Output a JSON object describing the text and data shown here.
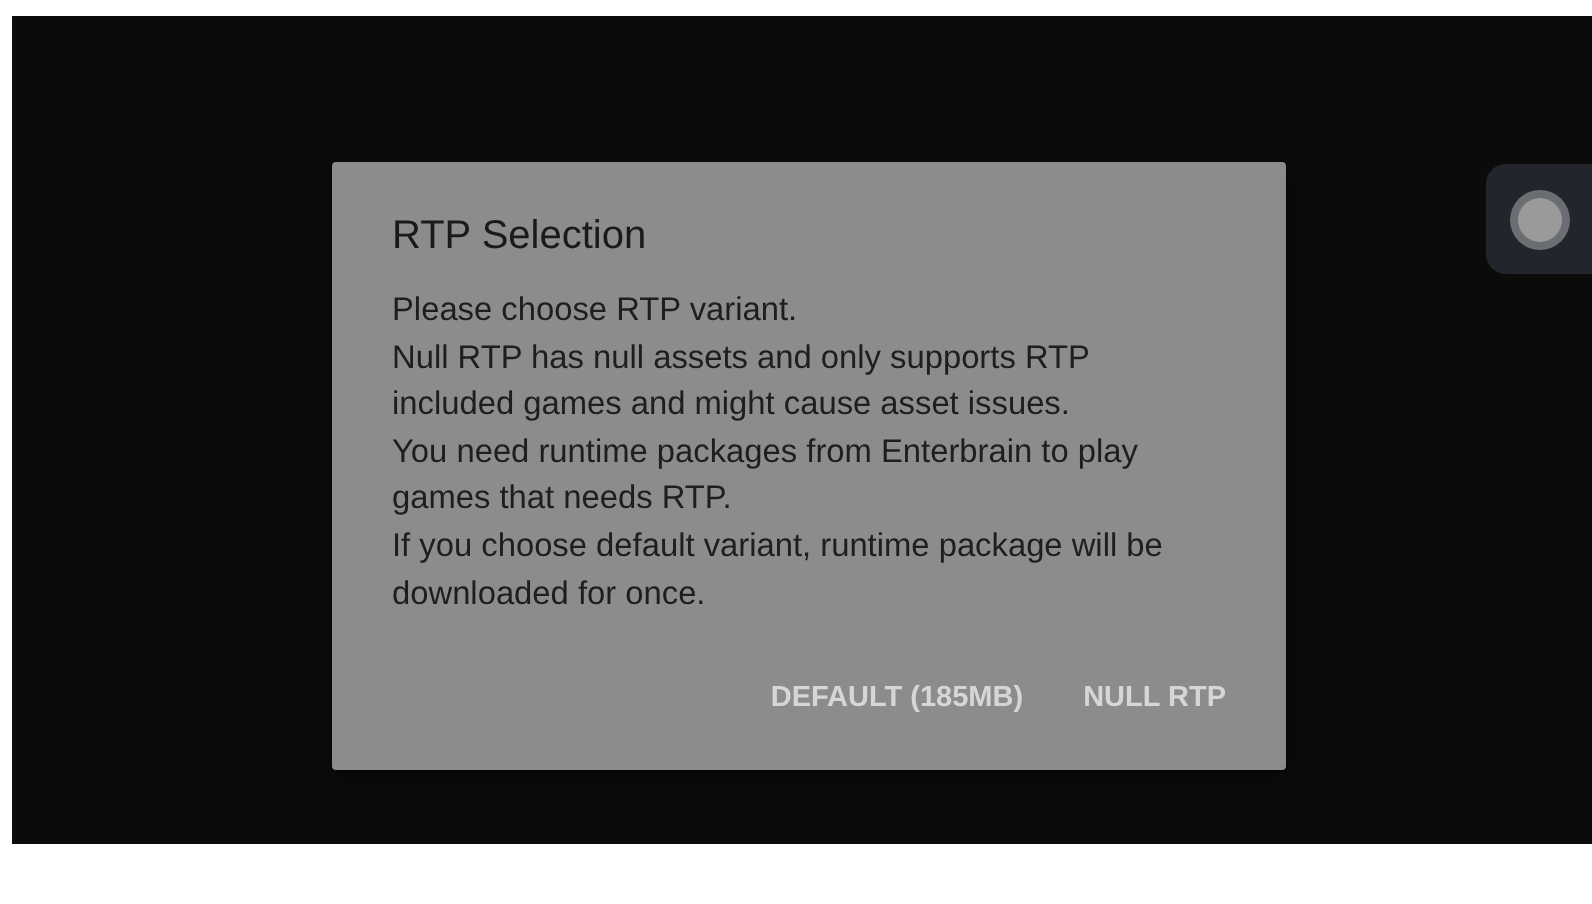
{
  "dialog": {
    "title": "RTP Selection",
    "message": [
      "Please choose RTP variant.",
      "Null RTP has null assets and only supports RTP included games and might cause asset issues.",
      "You need runtime packages from Enterbrain to play games that needs RTP.",
      "If you choose default variant, runtime package will be downloaded for once."
    ],
    "buttons": [
      {
        "label": "DEFAULT (185MB)"
      },
      {
        "label": "NULL RTP"
      }
    ]
  }
}
